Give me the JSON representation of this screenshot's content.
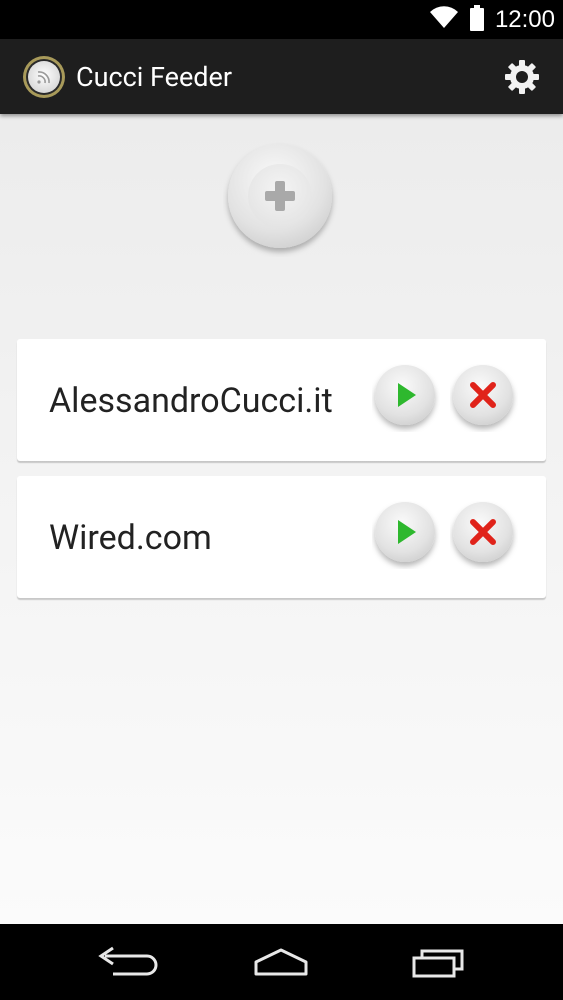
{
  "status_bar": {
    "time": "12:00",
    "icons": [
      "wifi-icon",
      "battery-icon"
    ]
  },
  "action_bar": {
    "title": "Cucci Feeder",
    "logo_icon": "rss-feed-logo",
    "settings_icon": "gear-icon"
  },
  "main": {
    "add_button_icon": "plus-icon",
    "feeds": [
      {
        "name": "AlessandroCucci.it",
        "play_icon": "play-icon",
        "delete_icon": "delete-x-icon"
      },
      {
        "name": "Wired.com",
        "play_icon": "play-icon",
        "delete_icon": "delete-x-icon"
      }
    ]
  },
  "nav_bar": {
    "icons": [
      "back-icon",
      "home-icon",
      "recents-icon"
    ]
  },
  "colors": {
    "action_bar_bg": "#1e1e1e",
    "play_green": "#2eb82e",
    "delete_red": "#e0231a",
    "logo_gold": "#a89a5a"
  }
}
